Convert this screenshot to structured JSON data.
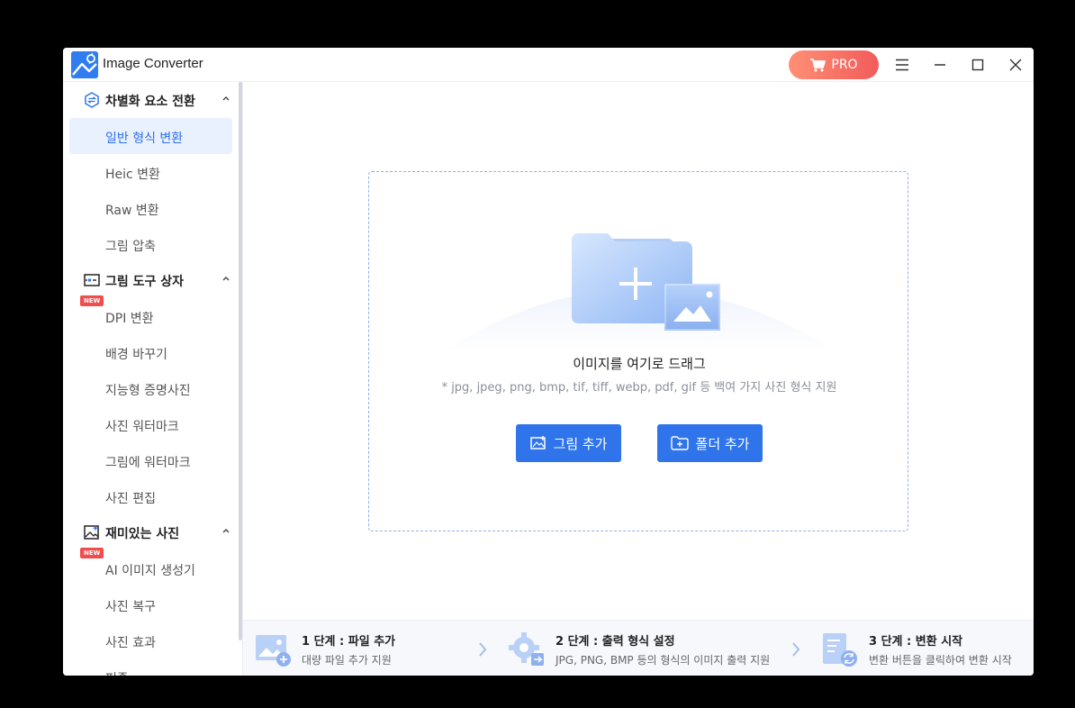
{
  "app": {
    "title": "Image Converter",
    "pro_label": "PRO",
    "brand_color": "#2f74ea",
    "pro_gradient": [
      "#ff8f75",
      "#f25b5b"
    ]
  },
  "window_controls": {
    "menu_icon": "hamburger-icon",
    "minimize_icon": "minimize-icon",
    "maximize_icon": "maximize-icon",
    "close_icon": "close-icon"
  },
  "sidebar": {
    "groups": [
      {
        "label": "차별화 요소 전환",
        "icon": "convert-icon",
        "items": [
          {
            "label": "일반 형식 변환",
            "active": true
          },
          {
            "label": "Heic 변환"
          },
          {
            "label": "Raw 변환"
          },
          {
            "label": "그림 압축"
          }
        ]
      },
      {
        "label": "그림 도구 상자",
        "icon": "toolbox-icon",
        "items": [
          {
            "label": "DPI 변환",
            "badge": "NEW"
          },
          {
            "label": "배경 바꾸기"
          },
          {
            "label": "지능형 증명사진"
          },
          {
            "label": "사진 워터마크"
          },
          {
            "label": "그림에 워터마크"
          },
          {
            "label": "사진 편집"
          }
        ]
      },
      {
        "label": "재미있는 사진",
        "icon": "photo-sparkle-icon",
        "items": [
          {
            "label": "AI 이미지 생성기",
            "badge": "NEW"
          },
          {
            "label": "사진 복구"
          },
          {
            "label": "사진 효과"
          },
          {
            "label": "퍼즐"
          }
        ]
      }
    ]
  },
  "drop_zone": {
    "title": "이미지를 여기로 드래그",
    "subtitle": "* jpg, jpeg, png, bmp, tif, tiff, webp, pdf, gif 등 백여 가지 사진 형식 지원",
    "add_image_label": "그림 추가",
    "add_folder_label": "폴더 추가"
  },
  "steps": [
    {
      "title": "1 단계 : 파일 추가",
      "subtitle": "대량 파일 추가 지원",
      "icon": "add-image-icon"
    },
    {
      "title": "2 단계 : 출력 형식 설정",
      "subtitle": "JPG, PNG, BMP 등의 형식의 이미지 출력 지원",
      "icon": "settings-gear-icon"
    },
    {
      "title": "3 단계 : 변환 시작",
      "subtitle": "변환 버튼을 클릭하여 변환 시작",
      "icon": "convert-document-icon"
    }
  ]
}
